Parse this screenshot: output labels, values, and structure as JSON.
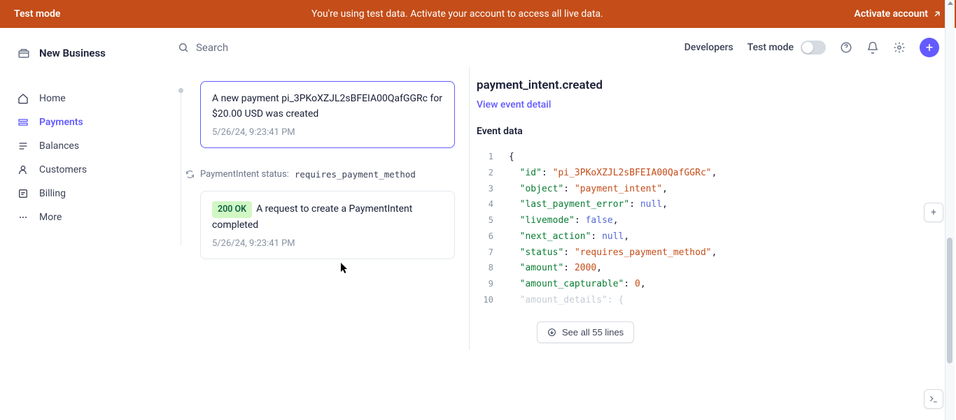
{
  "banner": {
    "left": "Test mode",
    "center": "You're using test data. Activate your account to access all live data.",
    "right": "Activate account"
  },
  "business": {
    "name": "New Business"
  },
  "nav": {
    "items": [
      {
        "label": "Home"
      },
      {
        "label": "Payments"
      },
      {
        "label": "Balances"
      },
      {
        "label": "Customers"
      },
      {
        "label": "Billing"
      },
      {
        "label": "More"
      }
    ]
  },
  "topbar": {
    "search_placeholder": "Search",
    "developers": "Developers",
    "test_mode": "Test mode"
  },
  "timeline": {
    "event1": {
      "title": "A new payment pi_3PKoXZJL2sBFEIA00QafGGRc for $20.00 USD was created",
      "time": "5/26/24, 9:23:41 PM"
    },
    "status": {
      "label": "PaymentIntent status:",
      "value": "requires_payment_method"
    },
    "event2": {
      "badge": "200 OK",
      "title": "A request to create a PaymentIntent completed",
      "time": "5/26/24, 9:23:41 PM"
    }
  },
  "detail": {
    "title": "payment_intent.created",
    "view_link": "View event detail",
    "section": "Event data",
    "see_all": "See all 55 lines",
    "code": [
      {
        "n": "1",
        "tokens": [
          [
            "punc",
            "{"
          ]
        ]
      },
      {
        "n": "2",
        "tokens": [
          [
            "indent",
            "  "
          ],
          [
            "key",
            "\"id\""
          ],
          [
            "punc",
            ": "
          ],
          [
            "str",
            "\"pi_3PKoXZJL2sBFEIA00QafGGRc\""
          ],
          [
            "punc",
            ","
          ]
        ]
      },
      {
        "n": "3",
        "tokens": [
          [
            "indent",
            "  "
          ],
          [
            "key",
            "\"object\""
          ],
          [
            "punc",
            ": "
          ],
          [
            "str",
            "\"payment_intent\""
          ],
          [
            "punc",
            ","
          ]
        ]
      },
      {
        "n": "4",
        "tokens": [
          [
            "indent",
            "  "
          ],
          [
            "key",
            "\"last_payment_error\""
          ],
          [
            "punc",
            ": "
          ],
          [
            "bool",
            "null"
          ],
          [
            "punc",
            ","
          ]
        ]
      },
      {
        "n": "5",
        "tokens": [
          [
            "indent",
            "  "
          ],
          [
            "key",
            "\"livemode\""
          ],
          [
            "punc",
            ": "
          ],
          [
            "bool",
            "false"
          ],
          [
            "punc",
            ","
          ]
        ]
      },
      {
        "n": "6",
        "tokens": [
          [
            "indent",
            "  "
          ],
          [
            "key",
            "\"next_action\""
          ],
          [
            "punc",
            ": "
          ],
          [
            "bool",
            "null"
          ],
          [
            "punc",
            ","
          ]
        ]
      },
      {
        "n": "7",
        "tokens": [
          [
            "indent",
            "  "
          ],
          [
            "key",
            "\"status\""
          ],
          [
            "punc",
            ": "
          ],
          [
            "str",
            "\"requires_payment_method\""
          ],
          [
            "punc",
            ","
          ]
        ]
      },
      {
        "n": "8",
        "tokens": [
          [
            "indent",
            "  "
          ],
          [
            "key",
            "\"amount\""
          ],
          [
            "punc",
            ": "
          ],
          [
            "num",
            "2000"
          ],
          [
            "punc",
            ","
          ]
        ]
      },
      {
        "n": "9",
        "tokens": [
          [
            "indent",
            "  "
          ],
          [
            "key",
            "\"amount_capturable\""
          ],
          [
            "punc",
            ": "
          ],
          [
            "num",
            "0"
          ],
          [
            "punc",
            ","
          ]
        ]
      },
      {
        "n": "10",
        "tokens": [
          [
            "indent",
            "  "
          ],
          [
            "key",
            "\"amount_details\""
          ],
          [
            "punc",
            ": {"
          ]
        ],
        "faded": true
      }
    ]
  }
}
